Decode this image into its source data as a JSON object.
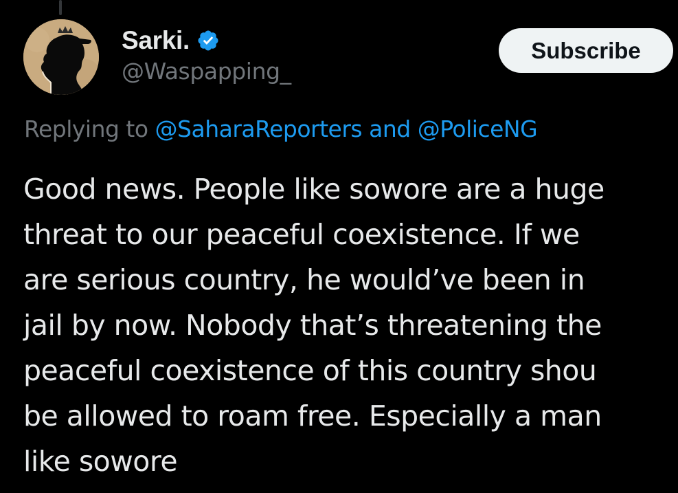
{
  "tweet": {
    "author": {
      "display_name": "Sarki.",
      "handle": "@Waspapping_",
      "verified": true,
      "avatar_icon": "silhouette-avatar"
    },
    "subscribe_label": "Subscribe",
    "reply_context": {
      "prefix": "Replying to",
      "mention_1": "@SaharaReporters",
      "joiner": "and",
      "mention_2": "@PoliceNG"
    },
    "text_lines": [
      "Good news. People like sowore are a huge",
      "threat to our peaceful coexistence. If we",
      "are serious country, he would’ve been in",
      "jail by now. Nobody that’s threatening the",
      "peaceful coexistence of this country shou",
      "be allowed to roam free. Especially a man",
      "like sowore"
    ]
  },
  "colors": {
    "background": "#000000",
    "text_primary": "#e7e9ea",
    "text_secondary": "#71767b",
    "accent": "#1d9bf0",
    "button_bg": "#eff3f4"
  }
}
